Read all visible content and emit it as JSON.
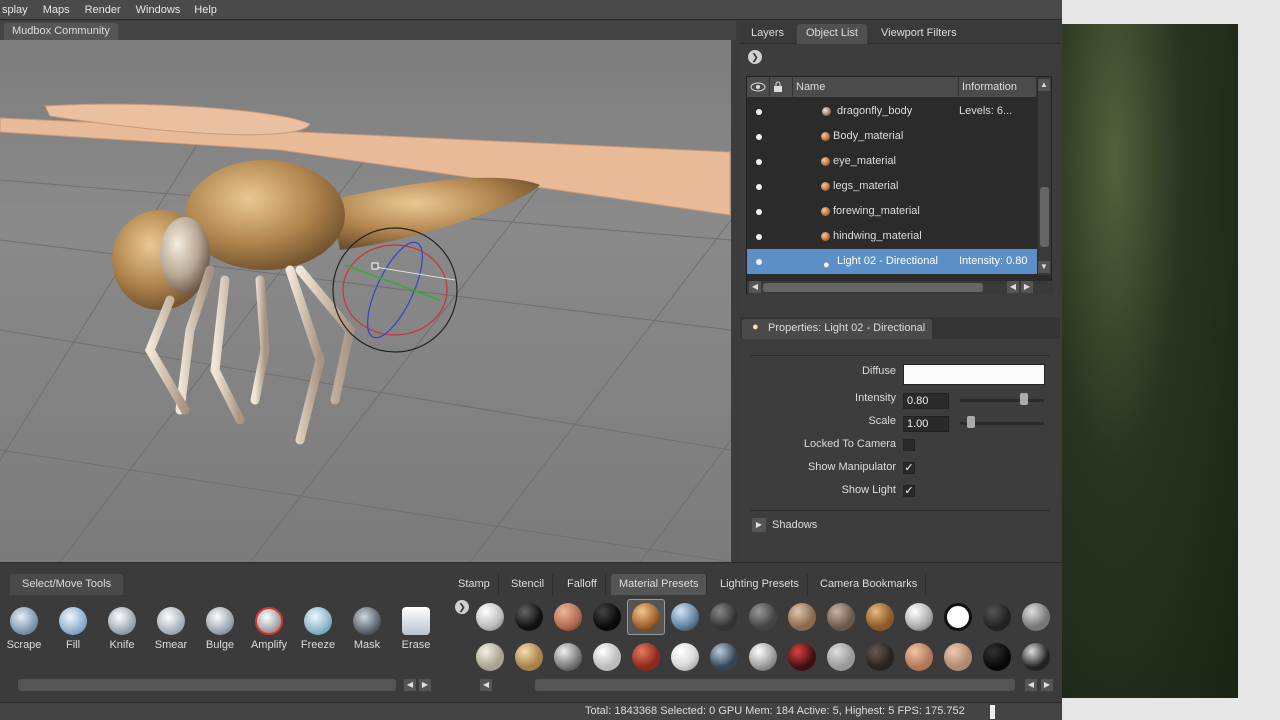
{
  "menubar": {
    "items": [
      "splay",
      "Maps",
      "Render",
      "Windows",
      "Help"
    ]
  },
  "viewport": {
    "tab_label": "Mudbox Community"
  },
  "right_panel": {
    "tabs": [
      "Layers",
      "Object List",
      "Viewport Filters"
    ],
    "active_tab": "Object List",
    "object_list": {
      "columns": {
        "name": "Name",
        "info": "Information"
      },
      "rows": [
        {
          "name": "dragonfly_body",
          "info": "Levels: 6..."
        },
        {
          "name": "Body_material",
          "info": ""
        },
        {
          "name": "eye_material",
          "info": ""
        },
        {
          "name": "legs_material",
          "info": ""
        },
        {
          "name": "forewing_material",
          "info": ""
        },
        {
          "name": "hindwing_material",
          "info": ""
        },
        {
          "name": "Light 02 - Directional",
          "info": "Intensity: 0.80"
        }
      ]
    },
    "properties": {
      "title": "Properties: Light 02 - Directional",
      "diffuse_label": "Diffuse",
      "intensity_label": "Intensity",
      "intensity_value": "0.80",
      "scale_label": "Scale",
      "scale_value": "1.00",
      "locked_label": "Locked To Camera",
      "show_manip_label": "Show Manipulator",
      "show_light_label": "Show Light",
      "shadows_label": "Shadows",
      "checkmark": "✓"
    }
  },
  "tools": {
    "tray_title": "Select/Move Tools",
    "items": [
      "Scrape",
      "Fill",
      "Knife",
      "Smear",
      "Bulge",
      "Amplify",
      "Freeze",
      "Mask",
      "Erase"
    ]
  },
  "presets": {
    "tabs": [
      "Stamp",
      "Stencil",
      "Falloff",
      "Material Presets",
      "Lighting Presets",
      "Camera Bookmarks"
    ],
    "active_tab": "Material Presets"
  },
  "status": {
    "text": "Total: 1843368  Selected: 0  GPU Mem: 184  Active: 5, Highest: 5  FPS: 175.752"
  },
  "colors": {
    "selection": "#5b8fc6",
    "wing": "#e7b999",
    "body": "#b98b55"
  }
}
